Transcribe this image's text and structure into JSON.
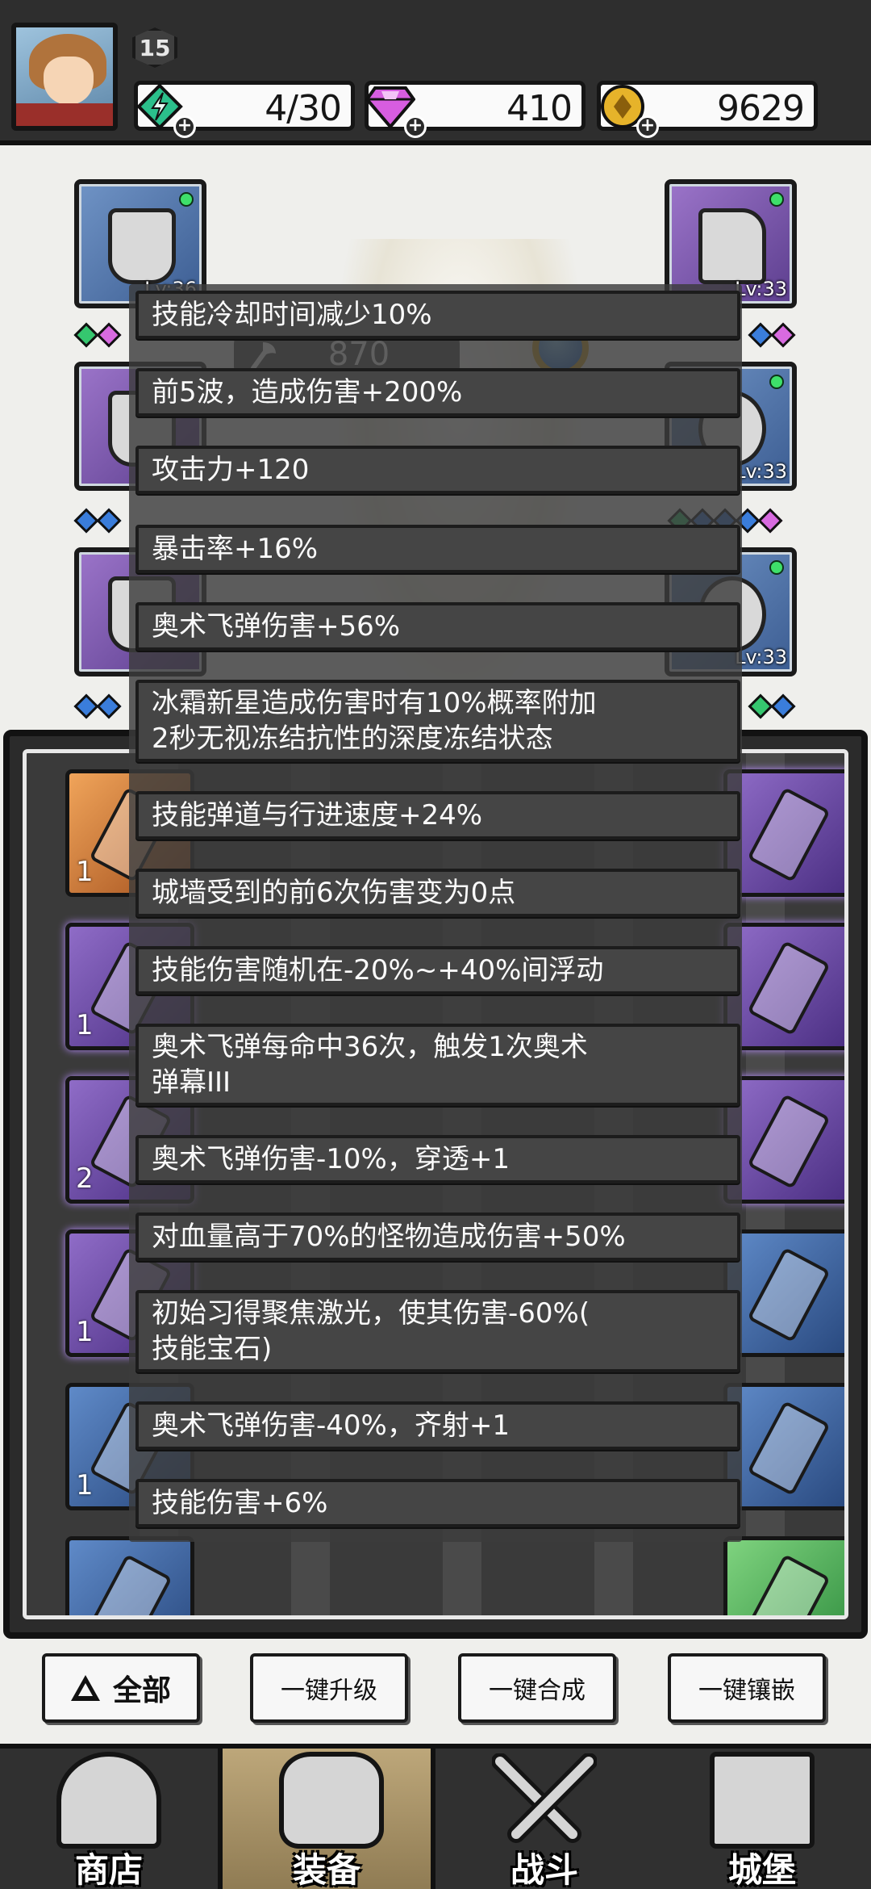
{
  "player": {
    "level": "15",
    "energy": "4/30",
    "gems": "410",
    "gold": "9629"
  },
  "hero": {
    "power": "870",
    "slots": [
      {
        "lv": "Lv:36"
      },
      {
        "lv": "Lv:33"
      },
      {
        "lv": "Lv:33"
      },
      {
        "lv": "Lv:33"
      }
    ]
  },
  "tooltip": {
    "lines": [
      "技能冷却时间减少10%",
      "前5波，造成伤害+200%",
      "攻击力+120",
      "暴击率+16%",
      "奥术飞弹伤害+56%",
      "冰霜新星造成伤害时有10%概率附加\n2秒无视冻结抗性的深度冻结状态",
      "技能弹道与行进速度+24%",
      "城墙受到的前6次伤害变为0点",
      "技能伤害随机在-20%~+40%间浮动",
      "奥术飞弹每命中36次，触发1次奥术\n弹幕III",
      "奥术飞弹伤害-10%，穿透+1",
      "对血量高于70%的怪物造成伤害+50%",
      "初始习得聚焦激光，使其伤害-60%(\n技能宝石)",
      "奥术飞弹伤害-40%，齐射+1",
      "技能伤害+6%"
    ]
  },
  "inventory": {
    "counts": [
      "1",
      "1",
      "2",
      "1",
      "1"
    ]
  },
  "actions": {
    "all": "全部",
    "upgrade": "一键升级",
    "merge": "一键合成",
    "inlay": "一键镶嵌"
  },
  "nav": {
    "shop": "商店",
    "equipment": "装备",
    "battle": "战斗",
    "castle": "城堡"
  },
  "colors": {
    "rarity_blue": "#4e74b0",
    "rarity_purple": "#7a55b3",
    "rarity_orange": "#d9823a",
    "rarity_green": "#5cb85c"
  }
}
